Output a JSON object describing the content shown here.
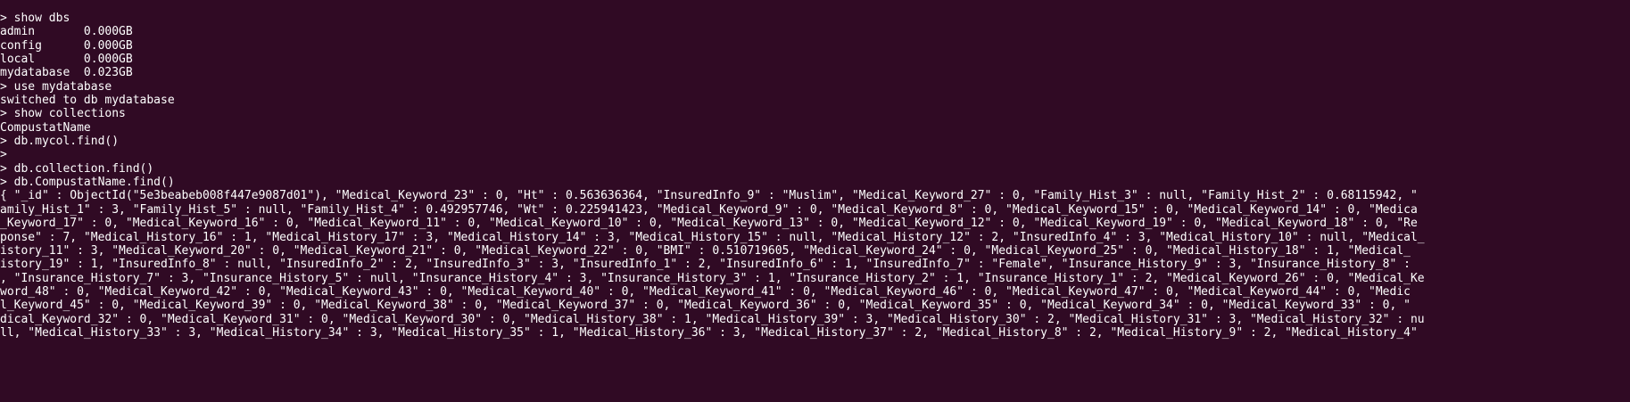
{
  "terminal": {
    "lines": [
      "> show dbs",
      "admin       0.000GB",
      "config      0.000GB",
      "local       0.000GB",
      "mydatabase  0.023GB",
      "> use mydatabase",
      "switched to db mydatabase",
      "> show collections",
      "CompustatName",
      "> db.mycol.find()",
      ">",
      "> db.collection.find()",
      "> db.CompustatName.find()",
      "{ \"_id\" : ObjectId(\"5e3beabeb008f447e9087d01\"), \"Medical_Keyword_23\" : 0, \"Ht\" : 0.563636364, \"InsuredInfo_9\" : \"Muslim\", \"Medical_Keyword_27\" : 0, \"Family_Hist_3\" : null, \"Family_Hist_2\" : 0.68115942, \"",
      "amily_Hist_1\" : 3, \"Family_Hist_5\" : null, \"Family_Hist_4\" : 0.492957746, \"Wt\" : 0.225941423, \"Medical_Keyword_9\" : 0, \"Medical_Keyword_8\" : 0, \"Medical_Keyword_15\" : 0, \"Medical_Keyword_14\" : 0, \"Medica",
      "_Keyword_17\" : 0, \"Medical_Keyword_16\" : 0, \"Medical_Keyword_11\" : 0, \"Medical_Keyword_10\" : 0, \"Medical_Keyword_13\" : 0, \"Medical_Keyword_12\" : 0, \"Medical_Keyword_19\" : 0, \"Medical_Keyword_18\" : 0, \"Re",
      "ponse\" : 7, \"Medical_History_16\" : 1, \"Medical_History_17\" : 3, \"Medical_History_14\" : 3, \"Medical_History_15\" : null, \"Medical_History_12\" : 2, \"InsuredInfo_4\" : 3, \"Medical_History_10\" : null, \"Medical_",
      "istory_11\" : 3, \"Medical_Keyword_20\" : 0, \"Medical_Keyword_21\" : 0, \"Medical_Keyword_22\" : 0, \"BMI\" : 0.510719605, \"Medical_Keyword_24\" : 0, \"Medical_Keyword_25\" : 0, \"Medical_History_18\" : 1, \"Medical_",
      "istory_19\" : 1, \"InsuredInfo_8\" : null, \"InsuredInfo_2\" : 2, \"InsuredInfo_3\" : 3, \"InsuredInfo_1\" : 2, \"InsuredInfo_6\" : 1, \"InsuredInfo_7\" : \"Female\", \"Insurance_History_9\" : 3, \"Insurance_History_8\" :",
      ", \"Insurance_History_7\" : 3, \"Insurance_History_5\" : null, \"Insurance_History_4\" : 3, \"Insurance_History_3\" : 1, \"Insurance_History_2\" : 1, \"Insurance_History_1\" : 2, \"Medical_Keyword_26\" : 0, \"Medical_Ke",
      "word_48\" : 0, \"Medical_Keyword_42\" : 0, \"Medical_Keyword_43\" : 0, \"Medical_Keyword_40\" : 0, \"Medical_Keyword_41\" : 0, \"Medical_Keyword_46\" : 0, \"Medical_Keyword_47\" : 0, \"Medical_Keyword_44\" : 0, \"Medic",
      "l_Keyword_45\" : 0, \"Medical_Keyword_39\" : 0, \"Medical_Keyword_38\" : 0, \"Medical_Keyword_37\" : 0, \"Medical_Keyword_36\" : 0, \"Medical_Keyword_35\" : 0, \"Medical_Keyword_34\" : 0, \"Medical_Keyword_33\" : 0, \"",
      "dical_Keyword_32\" : 0, \"Medical_Keyword_31\" : 0, \"Medical_Keyword_30\" : 0, \"Medical_History_38\" : 1, \"Medical_History_39\" : 3, \"Medical_History_30\" : 2, \"Medical_History_31\" : 3, \"Medical_History_32\" : nu",
      "ll, \"Medical_History_33\" : 3, \"Medical_History_34\" : 3, \"Medical_History_35\" : 1, \"Medical_History_36\" : 3, \"Medical_History_37\" : 2, \"Medical_History_8\" : 2, \"Medical_History_9\" : 2, \"Medical_History_4\""
    ]
  }
}
